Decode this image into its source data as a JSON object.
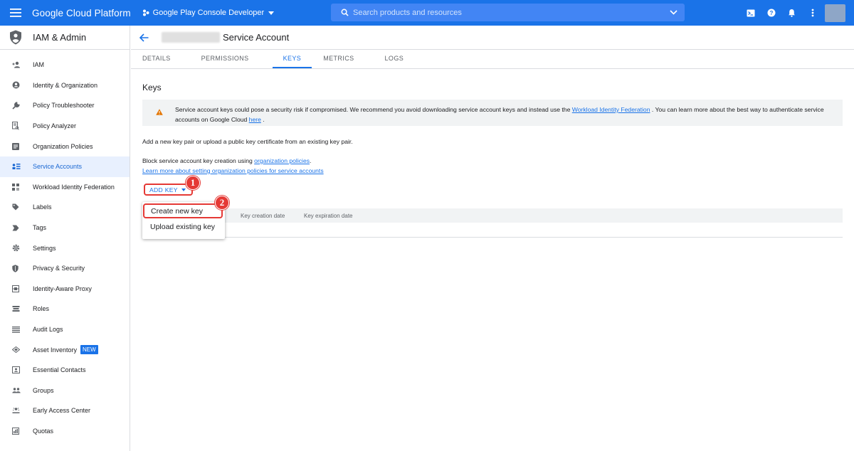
{
  "topbar": {
    "brand": "Google Cloud Platform",
    "project": "Google Play Console Developer",
    "search_placeholder": "Search products and resources",
    "icons": [
      "terminal-icon",
      "help-icon",
      "bell-icon",
      "more-vert-icon"
    ]
  },
  "sidebar": {
    "title": "IAM & Admin",
    "items": [
      {
        "label": "IAM",
        "icon": "person-add-icon"
      },
      {
        "label": "Identity & Organization",
        "icon": "account-circle-icon"
      },
      {
        "label": "Policy Troubleshooter",
        "icon": "wrench-icon"
      },
      {
        "label": "Policy Analyzer",
        "icon": "doc-search-icon"
      },
      {
        "label": "Organization Policies",
        "icon": "list-box-icon"
      },
      {
        "label": "Service Accounts",
        "icon": "service-account-icon",
        "active": true
      },
      {
        "label": "Workload Identity Federation",
        "icon": "grid-icon"
      },
      {
        "label": "Labels",
        "icon": "label-icon"
      },
      {
        "label": "Tags",
        "icon": "tag-arrow-icon"
      },
      {
        "label": "Settings",
        "icon": "gear-icon"
      },
      {
        "label": "Privacy & Security",
        "icon": "shield-icon"
      },
      {
        "label": "Identity-Aware Proxy",
        "icon": "proxy-icon"
      },
      {
        "label": "Roles",
        "icon": "roles-icon"
      },
      {
        "label": "Audit Logs",
        "icon": "lines-icon"
      },
      {
        "label": "Asset Inventory",
        "icon": "diamond-icon",
        "badge": "NEW"
      },
      {
        "label": "Essential Contacts",
        "icon": "contact-card-icon"
      },
      {
        "label": "Groups",
        "icon": "groups-icon"
      },
      {
        "label": "Early Access Center",
        "icon": "early-access-icon"
      },
      {
        "label": "Quotas",
        "icon": "quota-icon"
      }
    ]
  },
  "page": {
    "title": "Service Account",
    "tabs": [
      "DETAILS",
      "PERMISSIONS",
      "KEYS",
      "METRICS",
      "LOGS"
    ],
    "active_tab": "KEYS",
    "section_title": "Keys",
    "warning": {
      "text_a": "Service account keys could pose a security risk if compromised. We recommend you avoid downloading service account keys and instead use the ",
      "link_a": "Workload Identity Federation",
      "text_b": " . You can learn more about the best way to authenticate service accounts on Google Cloud ",
      "link_b": "here",
      "text_c": " ."
    },
    "info": "Add a new key pair or upload a public key certificate from an existing key pair.",
    "block_text": "Block service account key creation using ",
    "block_link": "organization policies",
    "block_end": ".",
    "learn_link": "Learn more about setting organization policies for service accounts",
    "add_key_label": "ADD KEY",
    "table_headers": [
      "Key creation date",
      "Key expiration date"
    ],
    "menu_items": [
      "Create new key",
      "Upload existing key"
    ],
    "markers": [
      "1",
      "2"
    ]
  },
  "colors": {
    "primary": "#1a73e8",
    "annotation": "#e53935",
    "warning": "#e37400"
  }
}
